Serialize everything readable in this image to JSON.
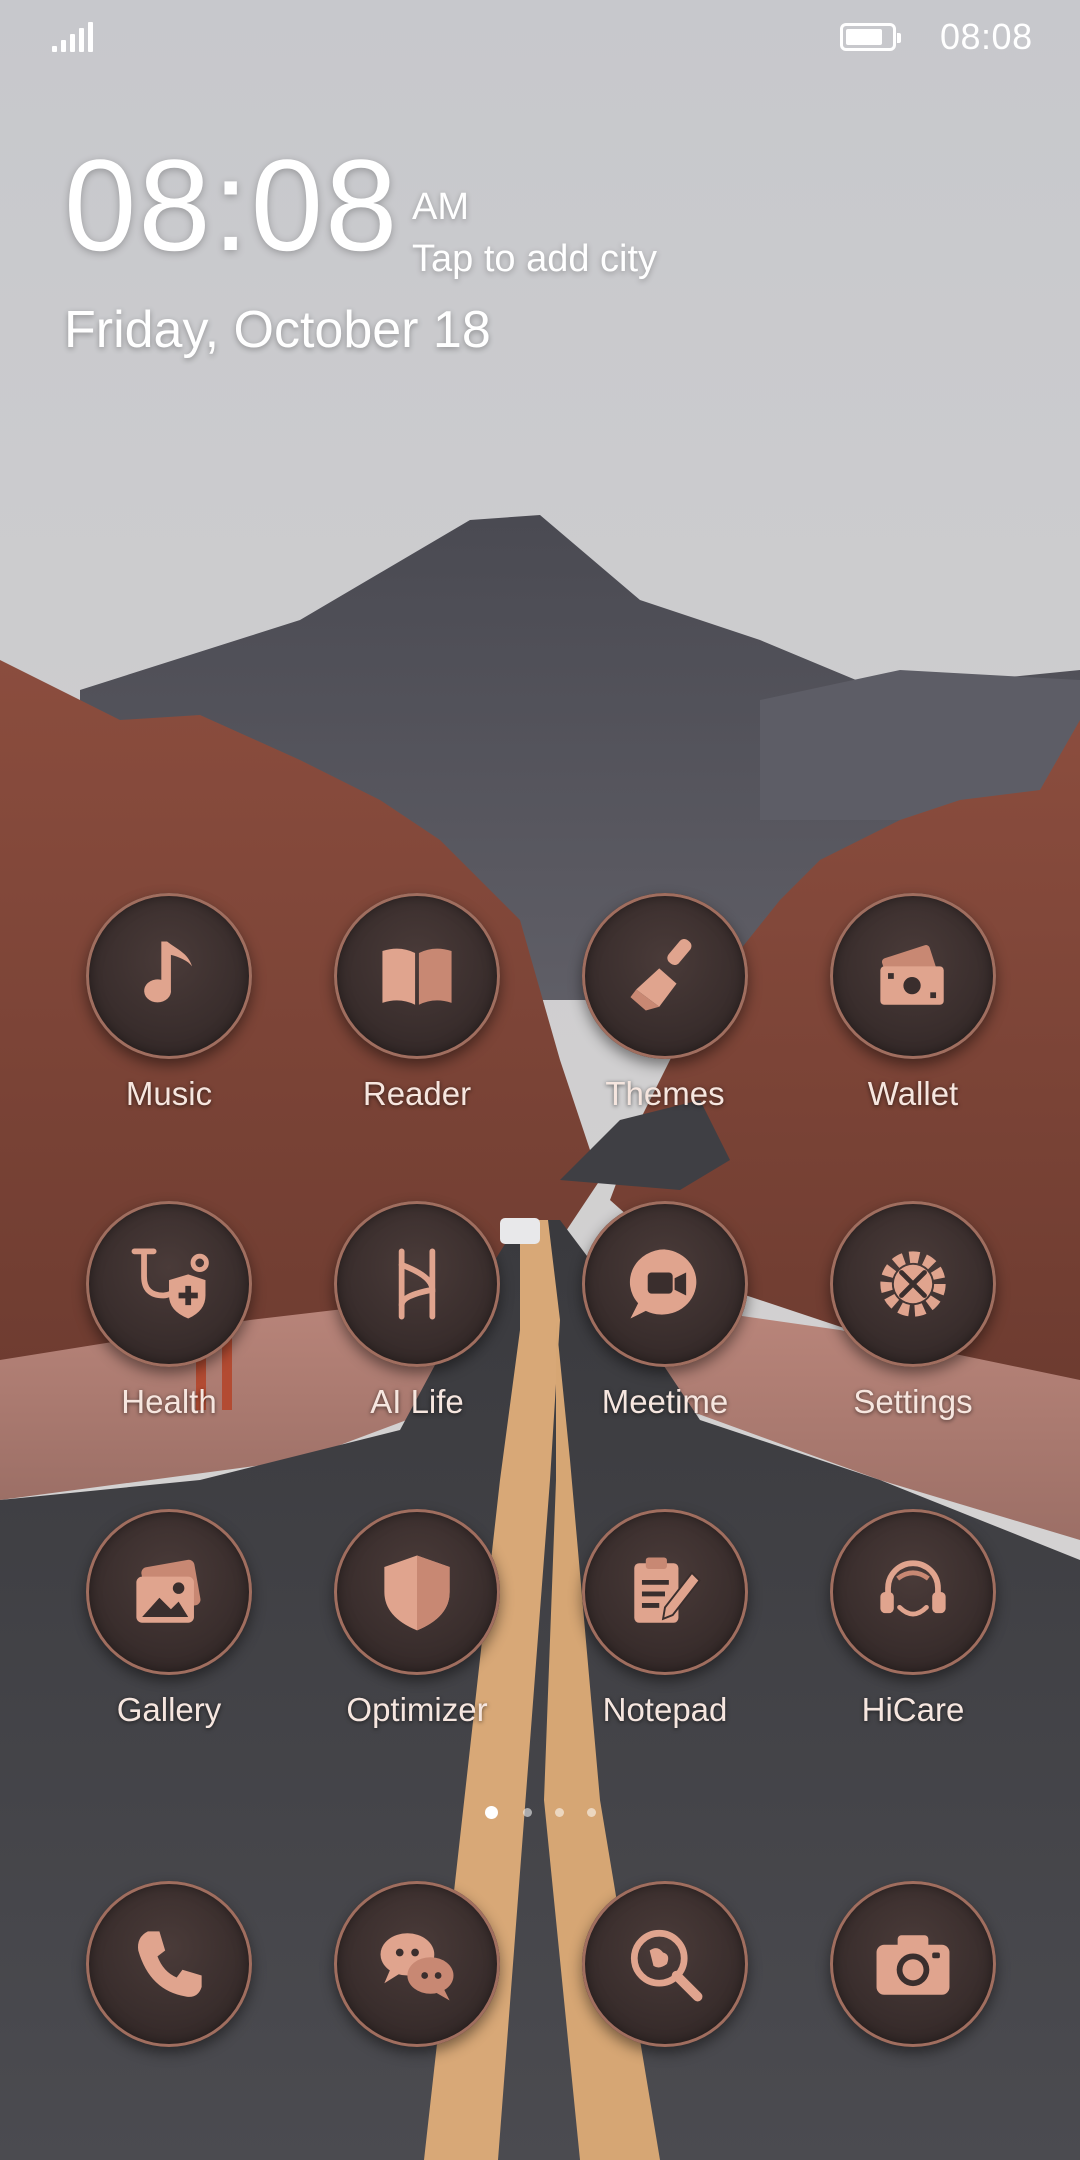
{
  "status_bar": {
    "time": "08:08",
    "battery_level": 1.0
  },
  "clock_widget": {
    "time": "08:08",
    "ampm": "AM",
    "city_prompt": "Tap to add city",
    "date": "Friday, October 18"
  },
  "apps": [
    {
      "label": "Music",
      "icon": "music-note-icon"
    },
    {
      "label": "Reader",
      "icon": "open-book-icon"
    },
    {
      "label": "Themes",
      "icon": "paintbrush-icon"
    },
    {
      "label": "Wallet",
      "icon": "wallet-cash-icon"
    },
    {
      "label": "Health",
      "icon": "stethoscope-shield-icon"
    },
    {
      "label": "AI Life",
      "icon": "ai-life-icon"
    },
    {
      "label": "Meetime",
      "icon": "video-call-bubble-icon"
    },
    {
      "label": "Settings",
      "icon": "gear-tools-icon"
    },
    {
      "label": "Gallery",
      "icon": "photos-icon"
    },
    {
      "label": "Optimizer",
      "icon": "shield-icon"
    },
    {
      "label": "Notepad",
      "icon": "notepad-pencil-icon"
    },
    {
      "label": "HiCare",
      "icon": "headset-person-icon"
    }
  ],
  "dock": [
    {
      "icon": "phone-icon"
    },
    {
      "icon": "chat-bubbles-icon"
    },
    {
      "icon": "globe-search-icon"
    },
    {
      "icon": "camera-icon"
    }
  ],
  "page_indicator": {
    "pages": 4,
    "current": 1
  },
  "colors": {
    "icon_accent": "#d89c86",
    "icon_ring": "#a06e5f",
    "icon_fill": "#3a2e2d"
  }
}
